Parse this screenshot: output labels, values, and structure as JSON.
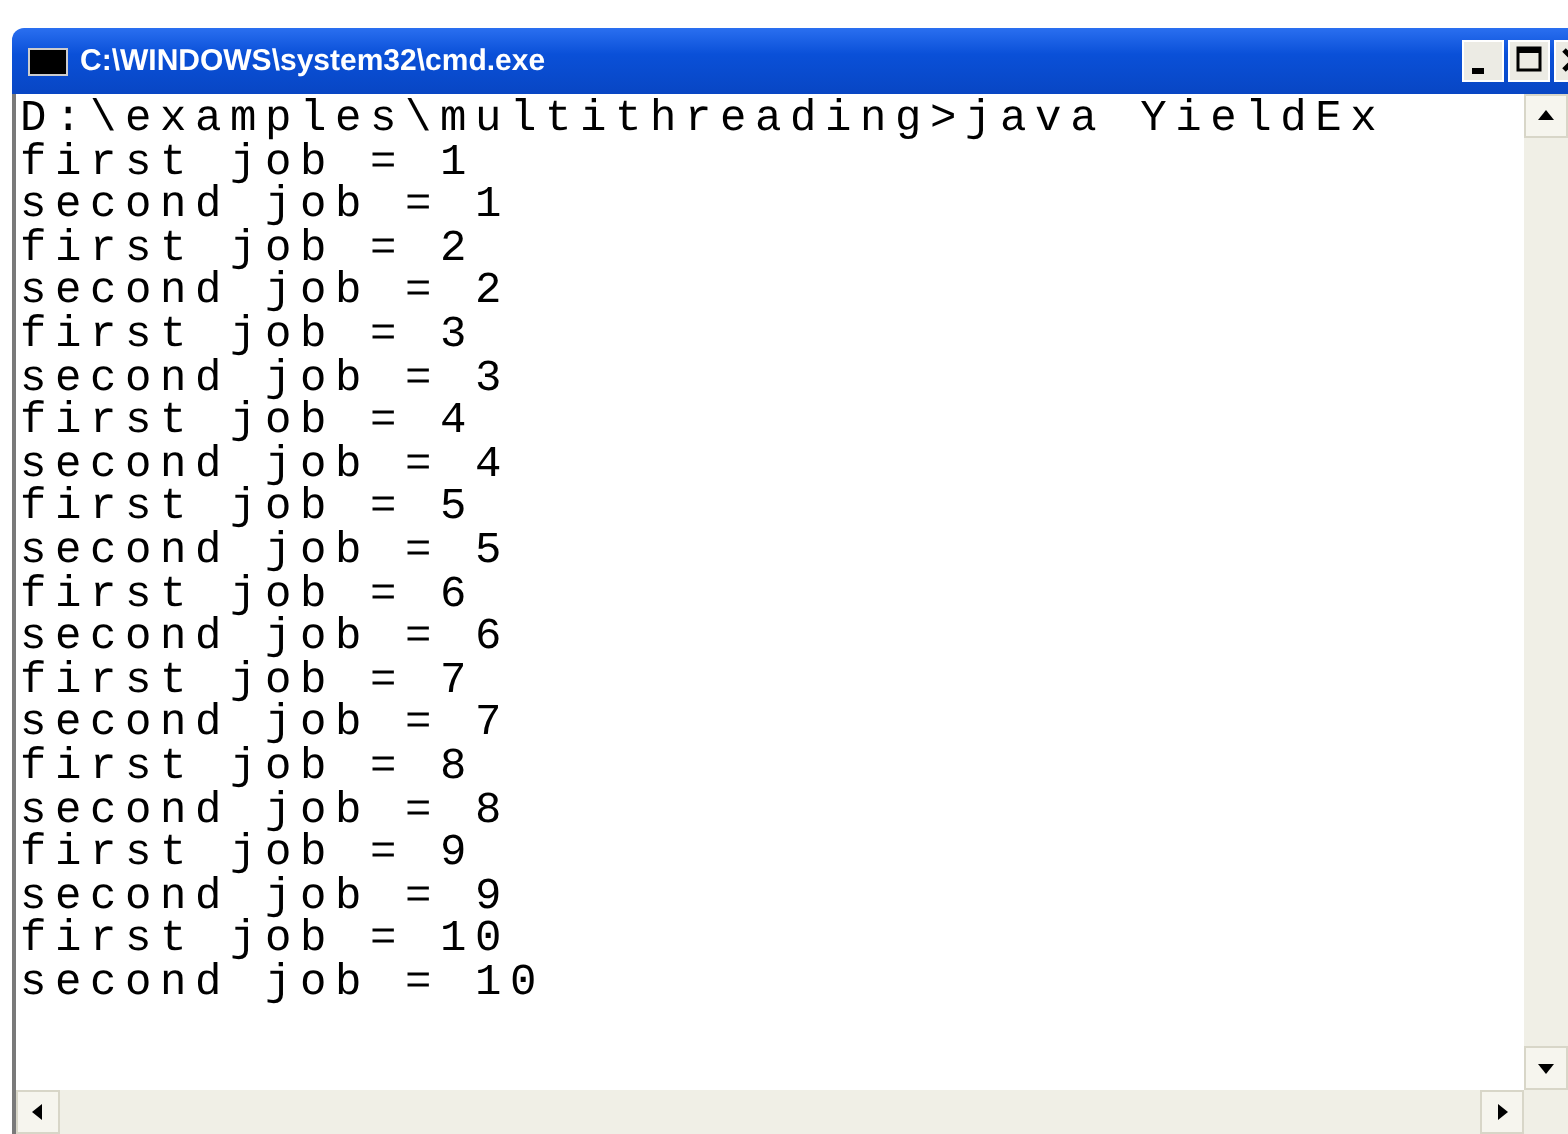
{
  "window": {
    "title": "C:\\WINDOWS\\system32\\cmd.exe"
  },
  "console": {
    "lines": [
      "D:\\examples\\multithreading>java YieldEx",
      "first job = 1",
      "second job = 1",
      "first job = 2",
      "second job = 2",
      "first job = 3",
      "second job = 3",
      "first job = 4",
      "second job = 4",
      "first job = 5",
      "second job = 5",
      "first job = 6",
      "second job = 6",
      "first job = 7",
      "second job = 7",
      "first job = 8",
      "second job = 8",
      "first job = 9",
      "second job = 9",
      "first job = 10",
      "second job = 10"
    ]
  }
}
